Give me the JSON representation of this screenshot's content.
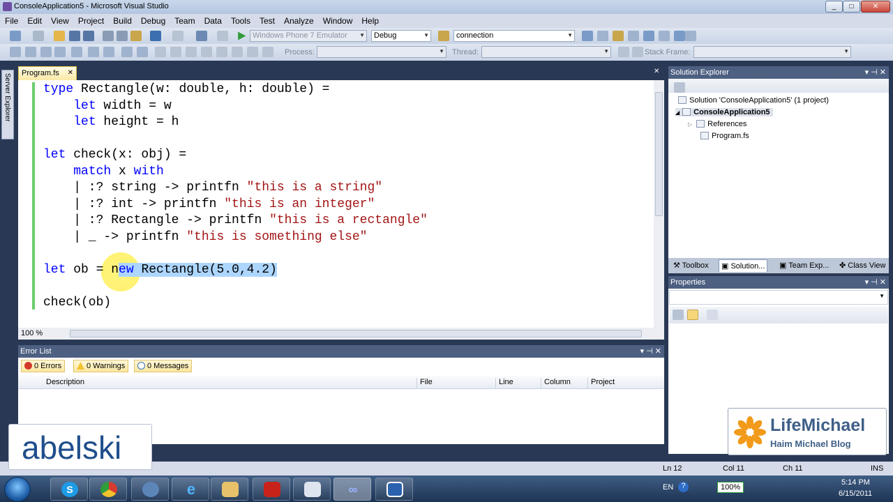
{
  "window": {
    "title": "ConsoleApplication5 - Microsoft Visual Studio",
    "controls": [
      "_",
      "□",
      "✕"
    ]
  },
  "menu": [
    "File",
    "Edit",
    "View",
    "Project",
    "Build",
    "Debug",
    "Team",
    "Data",
    "Tools",
    "Test",
    "Analyze",
    "Window",
    "Help"
  ],
  "toolbar": {
    "target_device": "Windows Phone 7 Emulator",
    "configuration": "Debug",
    "find_value": "connection",
    "process_label": "Process:",
    "thread_label": "Thread:",
    "stack_frame_label": "Stack Frame:"
  },
  "side_tab": "Server Explorer",
  "editor": {
    "tab_label": "Program.fs",
    "tab_close": "✕",
    "zoom": "100 %",
    "code_lines": [
      [
        {
          "t": "type",
          "c": "kw"
        },
        {
          "t": " Rectangle(w: double, h: double) ="
        }
      ],
      [
        {
          "t": "    "
        },
        {
          "t": "let",
          "c": "kw"
        },
        {
          "t": " width = w"
        }
      ],
      [
        {
          "t": "    "
        },
        {
          "t": "let",
          "c": "kw"
        },
        {
          "t": " height = h"
        }
      ],
      [
        {
          "t": ""
        }
      ],
      [
        {
          "t": "let",
          "c": "kw"
        },
        {
          "t": " check(x: obj) ="
        }
      ],
      [
        {
          "t": "    "
        },
        {
          "t": "match",
          "c": "kw"
        },
        {
          "t": " x "
        },
        {
          "t": "with",
          "c": "kw"
        }
      ],
      [
        {
          "t": "    | :? string -> printfn "
        },
        {
          "t": "\"this is a string\"",
          "c": "str"
        }
      ],
      [
        {
          "t": "    | :? int -> printfn "
        },
        {
          "t": "\"this is an integer\"",
          "c": "str"
        }
      ],
      [
        {
          "t": "    | :? Rectangle -> printfn "
        },
        {
          "t": "\"this is a rectangle\"",
          "c": "str"
        }
      ],
      [
        {
          "t": "    | _ -> printfn "
        },
        {
          "t": "\"this is something else\"",
          "c": "str"
        }
      ],
      [
        {
          "t": ""
        }
      ],
      [
        {
          "t": "let",
          "c": "kw"
        },
        {
          "t": " ob = n"
        },
        {
          "t": "ew",
          "c": "kw sel"
        },
        {
          "t": " Rectangle(5.0,4.2)",
          "c": "sel"
        }
      ],
      [
        {
          "t": ""
        }
      ],
      [
        {
          "t": "check(ob)"
        }
      ]
    ]
  },
  "error_list": {
    "title": "Error List",
    "errors": "0 Errors",
    "warnings": "0 Warnings",
    "messages": "0 Messages",
    "columns": [
      "Description",
      "File",
      "Line",
      "Column",
      "Project"
    ]
  },
  "solution_explorer": {
    "title": "Solution Explorer",
    "solution": "Solution 'ConsoleApplication5' (1 project)",
    "project": "ConsoleApplication5",
    "references": "References",
    "file": "Program.fs"
  },
  "dock_tabs": [
    "Toolbox",
    "Solution...",
    "Team Exp...",
    "Class View"
  ],
  "properties": {
    "title": "Properties"
  },
  "status": {
    "ln": "Ln 12",
    "col": "Col 11",
    "ch": "Ch 11",
    "mode": "INS"
  },
  "overlays": {
    "abelski": "abelski",
    "brand": "LifeMichael",
    "brand_sub": "Haim Michael Blog"
  },
  "tray": {
    "lang": "EN",
    "battery": "100%",
    "time": "5:14 PM",
    "date": "6/15/2011"
  },
  "colors": {
    "keyword": "#0000ff",
    "string": "#a31515",
    "selection": "#add6ff",
    "panel_header": "#4d6082"
  }
}
